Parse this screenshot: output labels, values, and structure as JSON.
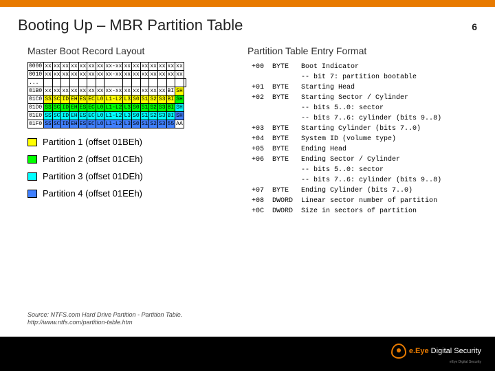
{
  "page": {
    "title": "Booting Up – MBR Partition Table",
    "number": "6"
  },
  "left_title": "Master Boot Record Layout",
  "right_title": "Partition Table Entry Format",
  "hex_rows": [
    {
      "addr": "0000",
      "cells": [
        "xx",
        "xx",
        "xx",
        "xx",
        "xx",
        "xx",
        "xx",
        "xx-xx",
        "xx",
        "xx",
        "xx",
        "xx",
        "xx",
        "xx",
        "xx"
      ],
      "classes": [
        "",
        "",
        "",
        "",
        "",
        "",
        "",
        "",
        "",
        "",
        "",
        "",
        "",
        "",
        "",
        ""
      ]
    },
    {
      "addr": "0010",
      "cells": [
        "xx",
        "xx",
        "xx",
        "xx",
        "xx",
        "xx",
        "xx",
        "xx-xx",
        "xx",
        "xx",
        "xx",
        "xx",
        "xx",
        "xx",
        "xx"
      ],
      "classes": [
        "",
        "",
        "",
        "",
        "",
        "",
        "",
        "",
        "",
        "",
        "",
        "",
        "",
        "",
        "",
        ""
      ]
    },
    {
      "addr": "...",
      "cells": [
        "",
        "",
        "",
        "",
        "",
        "",
        "",
        "",
        "",
        "",
        "",
        "",
        "",
        "",
        "",
        ""
      ],
      "classes": [
        "",
        "",
        "",
        "",
        "",
        "",
        "",
        "",
        "",
        "",
        "",
        "",
        "",
        "",
        "",
        ""
      ]
    },
    {
      "addr": "01B0",
      "cells": [
        "xx",
        "xx",
        "xx",
        "xx",
        "xx",
        "xx",
        "xx",
        "xx-xx",
        "xx",
        "xx",
        "xx",
        "xx",
        "xx",
        "BI",
        "SH"
      ],
      "classes": [
        "",
        "",
        "",
        "",
        "",
        "",
        "",
        "",
        "",
        "",
        "",
        "",
        "",
        "",
        "p1",
        "p1"
      ]
    },
    {
      "addr": "01C0",
      "cells": [
        "SS",
        "SC",
        "ID",
        "EH",
        "ES",
        "EC",
        "L0",
        "L1-L2",
        "L3",
        "S0",
        "S1",
        "S2",
        "S3",
        "BI",
        "SH"
      ],
      "classes": [
        "p1",
        "p1",
        "p1",
        "p1",
        "p1",
        "p1",
        "p1",
        "p1",
        "p1",
        "p1",
        "p1",
        "p1",
        "p1",
        "p1",
        "p2",
        "p2"
      ]
    },
    {
      "addr": "01D0",
      "cells": [
        "SS",
        "SC",
        "ID",
        "EH",
        "ES",
        "EC",
        "L0",
        "L1-L2",
        "L3",
        "S0",
        "S1",
        "S2",
        "S3",
        "BI",
        "SH"
      ],
      "classes": [
        "p2",
        "p2",
        "p2",
        "p2",
        "p2",
        "p2",
        "p2",
        "p2",
        "p2",
        "p2",
        "p2",
        "p2",
        "p2",
        "p2",
        "p3",
        "p3"
      ]
    },
    {
      "addr": "01E0",
      "cells": [
        "SS",
        "SC",
        "ID",
        "EH",
        "ES",
        "EC",
        "L0",
        "L1-L2",
        "L3",
        "S0",
        "S1",
        "S2",
        "S3",
        "BI",
        "SH"
      ],
      "classes": [
        "p3",
        "p3",
        "p3",
        "p3",
        "p3",
        "p3",
        "p3",
        "p3",
        "p3",
        "p3",
        "p3",
        "p3",
        "p3",
        "p3",
        "p4",
        "p4"
      ]
    },
    {
      "addr": "01F0",
      "cells": [
        "SS",
        "SC",
        "ID",
        "EH",
        "ES",
        "EC",
        "L0",
        "L1-L2",
        "L3",
        "S0",
        "S1",
        "S2",
        "S3",
        "55",
        "AA"
      ],
      "classes": [
        "p4",
        "p4",
        "p4",
        "p4",
        "p4",
        "p4",
        "p4",
        "p4",
        "p4",
        "p4",
        "p4",
        "p4",
        "p4",
        "p4",
        "",
        ""
      ]
    }
  ],
  "legend": [
    {
      "color_class": "p1",
      "label": "Partition 1 (offset 01BEh)"
    },
    {
      "color_class": "p2",
      "label": "Partition 2 (offset 01CEh)"
    },
    {
      "color_class": "p3",
      "label": "Partition 3 (offset 01DEh)"
    },
    {
      "color_class": "p4",
      "label": "Partition 4 (offset 01EEh)"
    }
  ],
  "entries": [
    {
      "off": "+00",
      "type": "BYTE",
      "desc": "Boot Indicator"
    },
    {
      "off": "",
      "type": "",
      "desc": "-- bit 7: partition bootable"
    },
    {
      "off": "+01",
      "type": "BYTE",
      "desc": "Starting Head"
    },
    {
      "off": "+02",
      "type": "BYTE",
      "desc": "Starting Sector / Cylinder"
    },
    {
      "off": "",
      "type": "",
      "desc": "-- bits 5..0: sector"
    },
    {
      "off": "",
      "type": "",
      "desc": "-- bits 7..6: cylinder (bits 9..8)"
    },
    {
      "off": "+03",
      "type": "BYTE",
      "desc": "Starting Cylinder (bits 7..0)"
    },
    {
      "off": "+04",
      "type": "BYTE",
      "desc": "System ID (volume type)"
    },
    {
      "off": "+05",
      "type": "BYTE",
      "desc": "Ending Head"
    },
    {
      "off": "+06",
      "type": "BYTE",
      "desc": "Ending Sector / Cylinder"
    },
    {
      "off": "",
      "type": "",
      "desc": "-- bits 5..0: sector"
    },
    {
      "off": "",
      "type": "",
      "desc": "-- bits 7..6: cylinder (bits 9..8)"
    },
    {
      "off": "+07",
      "type": "BYTE",
      "desc": "Ending Cylinder (bits 7..0)"
    },
    {
      "off": "+08",
      "type": "DWORD",
      "desc": "Linear sector number of partition"
    },
    {
      "off": "+0C",
      "type": "DWORD",
      "desc": "Size in sectors of partition"
    }
  ],
  "source": {
    "line1": "Source: NTFS.com Hard Drive Partition - Partition Table.",
    "line2": "http://www.ntfs.com/partition-table.htm"
  },
  "brand": {
    "prefix": "e.Eye ",
    "main": "Digital Security",
    "tagline": "eEye Digital Security"
  }
}
